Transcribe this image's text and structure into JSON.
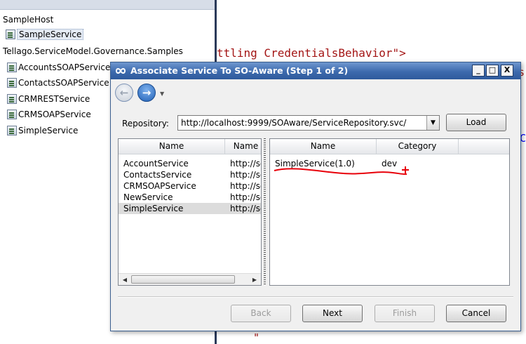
{
  "explorer": {
    "host": "SampleHost",
    "host_item": "SampleService",
    "project": "Tellago.ServiceModel.Governance.Samples",
    "items": [
      "AccountsSOAPService",
      "ContactsSOAPService",
      "CRMRESTService",
      "CRMSOAPService",
      "SimpleService"
    ]
  },
  "editor": {
    "code_line": "ttling CredentialsBehavior\">",
    "edge_quote": "\""
  },
  "dialog": {
    "title": "Associate Service To SO-Aware (Step 1 of 2)",
    "window_buttons": {
      "minimize": "_",
      "maximize": "□",
      "close": "X"
    },
    "repository_label": "Repository:",
    "repository_value": "http://localhost:9999/SOAware/ServiceRepository.svc/",
    "load_label": "Load",
    "left_list": {
      "columns": [
        "Name",
        "Name"
      ],
      "rows": [
        {
          "name": "AccountService",
          "url": "http://sc"
        },
        {
          "name": "ContactsService",
          "url": "http://sc"
        },
        {
          "name": "CRMSOAPService",
          "url": "http://sc"
        },
        {
          "name": "NewService",
          "url": "http://sc"
        },
        {
          "name": "SimpleService",
          "url": "http://sc",
          "selected": true
        }
      ]
    },
    "right_list": {
      "columns": [
        "Name",
        "Category"
      ],
      "rows": [
        {
          "name": "SimpleService(1.0)",
          "category": "dev"
        }
      ]
    },
    "buttons": {
      "back": "Back",
      "next": "Next",
      "finish": "Finish",
      "cancel": "Cancel"
    }
  },
  "colors": {
    "title_bar": "#3d6aad",
    "annotation": "#e8000a",
    "selection": "#dcdcdc"
  }
}
